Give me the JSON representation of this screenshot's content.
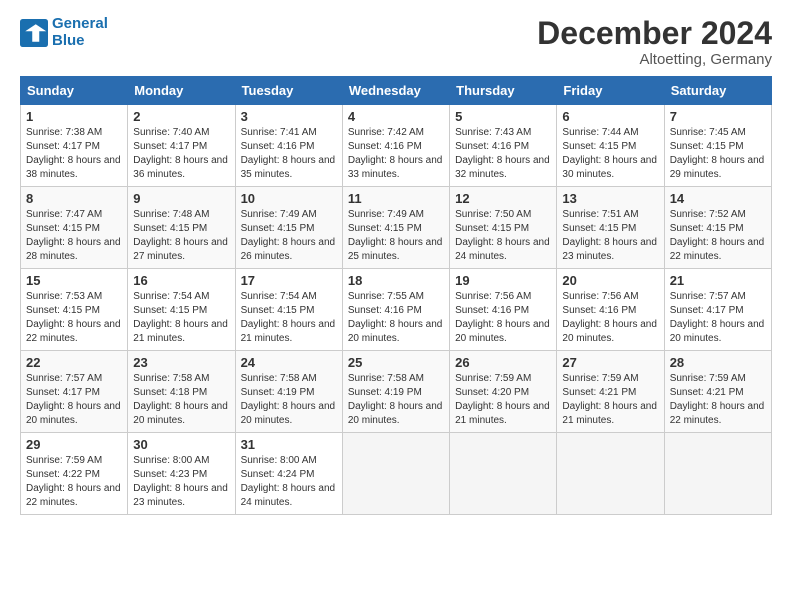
{
  "header": {
    "logo_line1": "General",
    "logo_line2": "Blue",
    "month_title": "December 2024",
    "location": "Altoetting, Germany"
  },
  "days_of_week": [
    "Sunday",
    "Monday",
    "Tuesday",
    "Wednesday",
    "Thursday",
    "Friday",
    "Saturday"
  ],
  "weeks": [
    [
      {
        "day": "1",
        "sunrise": "7:38 AM",
        "sunset": "4:17 PM",
        "daylight": "8 hours and 38 minutes."
      },
      {
        "day": "2",
        "sunrise": "7:40 AM",
        "sunset": "4:17 PM",
        "daylight": "8 hours and 36 minutes."
      },
      {
        "day": "3",
        "sunrise": "7:41 AM",
        "sunset": "4:16 PM",
        "daylight": "8 hours and 35 minutes."
      },
      {
        "day": "4",
        "sunrise": "7:42 AM",
        "sunset": "4:16 PM",
        "daylight": "8 hours and 33 minutes."
      },
      {
        "day": "5",
        "sunrise": "7:43 AM",
        "sunset": "4:16 PM",
        "daylight": "8 hours and 32 minutes."
      },
      {
        "day": "6",
        "sunrise": "7:44 AM",
        "sunset": "4:15 PM",
        "daylight": "8 hours and 30 minutes."
      },
      {
        "day": "7",
        "sunrise": "7:45 AM",
        "sunset": "4:15 PM",
        "daylight": "8 hours and 29 minutes."
      }
    ],
    [
      {
        "day": "8",
        "sunrise": "7:47 AM",
        "sunset": "4:15 PM",
        "daylight": "8 hours and 28 minutes."
      },
      {
        "day": "9",
        "sunrise": "7:48 AM",
        "sunset": "4:15 PM",
        "daylight": "8 hours and 27 minutes."
      },
      {
        "day": "10",
        "sunrise": "7:49 AM",
        "sunset": "4:15 PM",
        "daylight": "8 hours and 26 minutes."
      },
      {
        "day": "11",
        "sunrise": "7:49 AM",
        "sunset": "4:15 PM",
        "daylight": "8 hours and 25 minutes."
      },
      {
        "day": "12",
        "sunrise": "7:50 AM",
        "sunset": "4:15 PM",
        "daylight": "8 hours and 24 minutes."
      },
      {
        "day": "13",
        "sunrise": "7:51 AM",
        "sunset": "4:15 PM",
        "daylight": "8 hours and 23 minutes."
      },
      {
        "day": "14",
        "sunrise": "7:52 AM",
        "sunset": "4:15 PM",
        "daylight": "8 hours and 22 minutes."
      }
    ],
    [
      {
        "day": "15",
        "sunrise": "7:53 AM",
        "sunset": "4:15 PM",
        "daylight": "8 hours and 22 minutes."
      },
      {
        "day": "16",
        "sunrise": "7:54 AM",
        "sunset": "4:15 PM",
        "daylight": "8 hours and 21 minutes."
      },
      {
        "day": "17",
        "sunrise": "7:54 AM",
        "sunset": "4:15 PM",
        "daylight": "8 hours and 21 minutes."
      },
      {
        "day": "18",
        "sunrise": "7:55 AM",
        "sunset": "4:16 PM",
        "daylight": "8 hours and 20 minutes."
      },
      {
        "day": "19",
        "sunrise": "7:56 AM",
        "sunset": "4:16 PM",
        "daylight": "8 hours and 20 minutes."
      },
      {
        "day": "20",
        "sunrise": "7:56 AM",
        "sunset": "4:16 PM",
        "daylight": "8 hours and 20 minutes."
      },
      {
        "day": "21",
        "sunrise": "7:57 AM",
        "sunset": "4:17 PM",
        "daylight": "8 hours and 20 minutes."
      }
    ],
    [
      {
        "day": "22",
        "sunrise": "7:57 AM",
        "sunset": "4:17 PM",
        "daylight": "8 hours and 20 minutes."
      },
      {
        "day": "23",
        "sunrise": "7:58 AM",
        "sunset": "4:18 PM",
        "daylight": "8 hours and 20 minutes."
      },
      {
        "day": "24",
        "sunrise": "7:58 AM",
        "sunset": "4:19 PM",
        "daylight": "8 hours and 20 minutes."
      },
      {
        "day": "25",
        "sunrise": "7:58 AM",
        "sunset": "4:19 PM",
        "daylight": "8 hours and 20 minutes."
      },
      {
        "day": "26",
        "sunrise": "7:59 AM",
        "sunset": "4:20 PM",
        "daylight": "8 hours and 21 minutes."
      },
      {
        "day": "27",
        "sunrise": "7:59 AM",
        "sunset": "4:21 PM",
        "daylight": "8 hours and 21 minutes."
      },
      {
        "day": "28",
        "sunrise": "7:59 AM",
        "sunset": "4:21 PM",
        "daylight": "8 hours and 22 minutes."
      }
    ],
    [
      {
        "day": "29",
        "sunrise": "7:59 AM",
        "sunset": "4:22 PM",
        "daylight": "8 hours and 22 minutes."
      },
      {
        "day": "30",
        "sunrise": "8:00 AM",
        "sunset": "4:23 PM",
        "daylight": "8 hours and 23 minutes."
      },
      {
        "day": "31",
        "sunrise": "8:00 AM",
        "sunset": "4:24 PM",
        "daylight": "8 hours and 24 minutes."
      },
      null,
      null,
      null,
      null
    ]
  ]
}
